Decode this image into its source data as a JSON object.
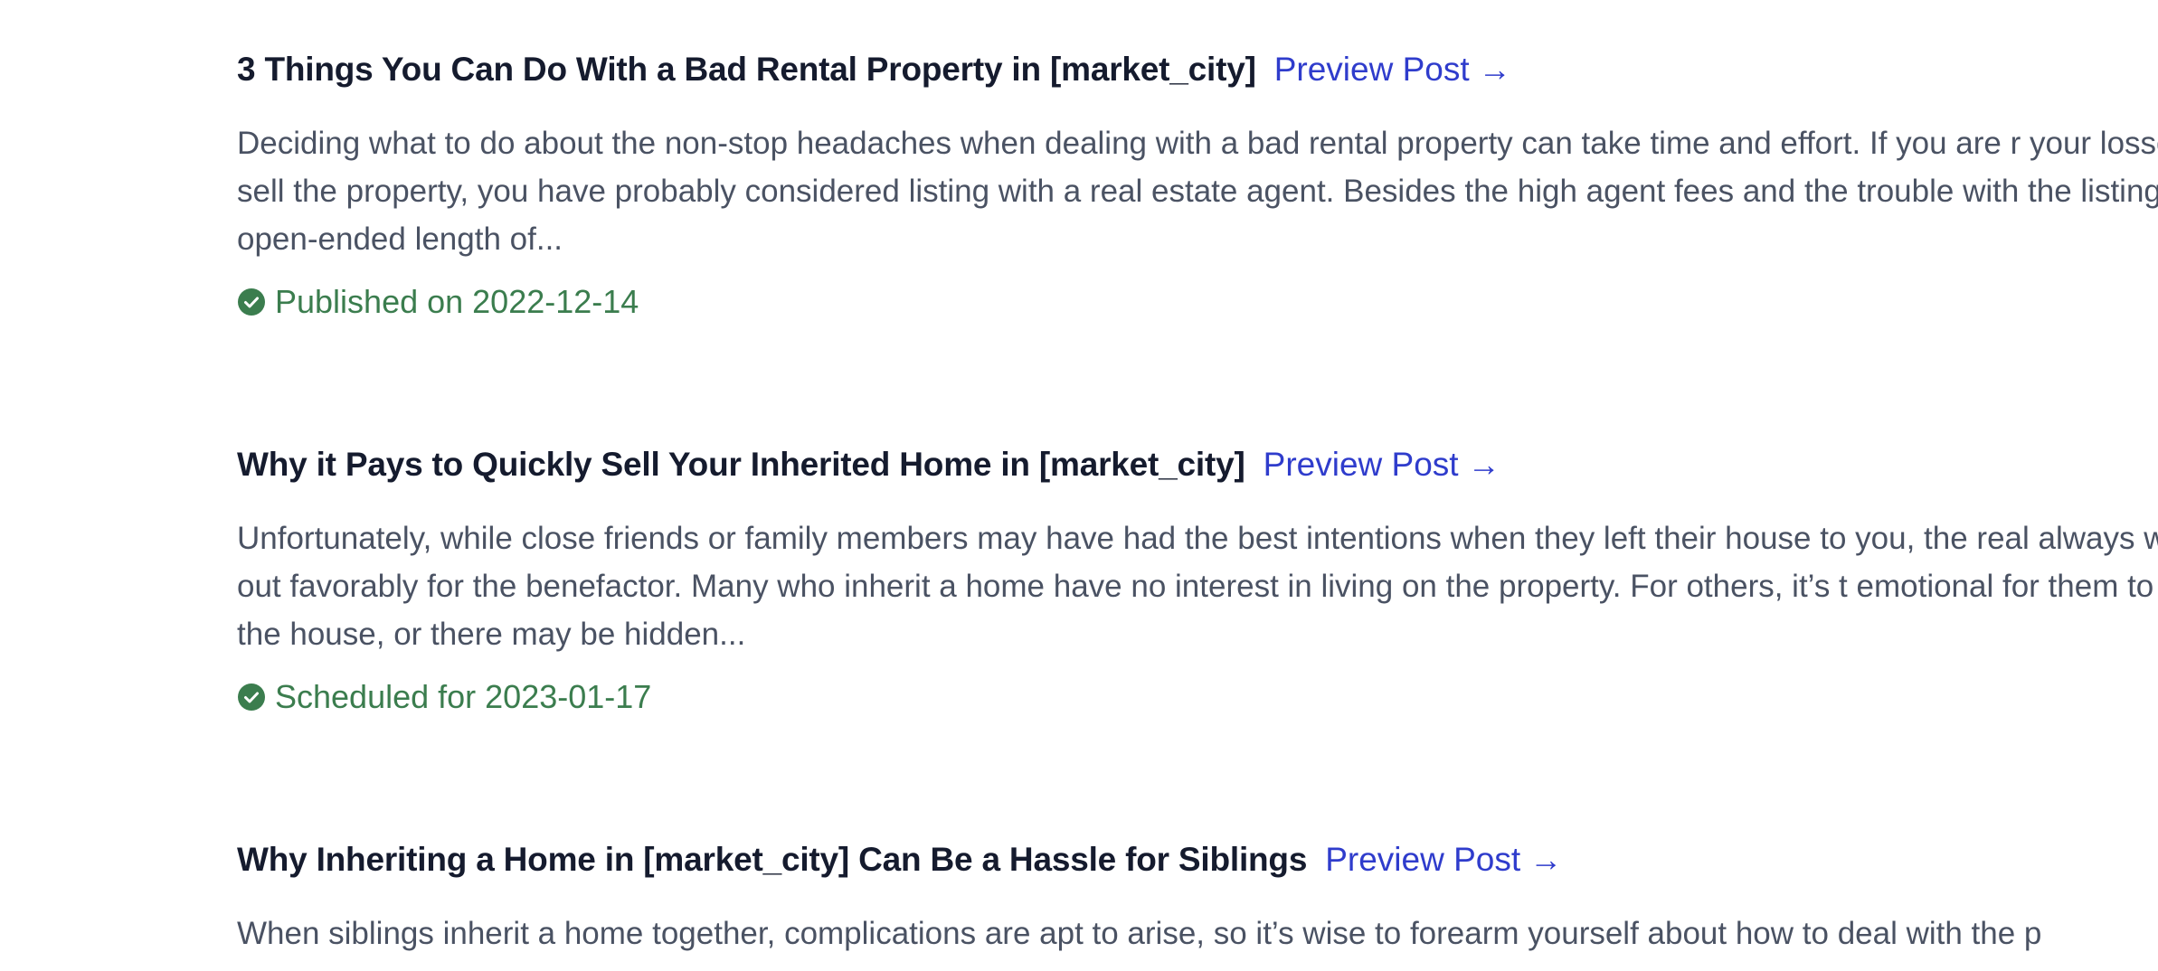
{
  "posts": [
    {
      "title": "3 Things You Can Do With a Bad Rental Property in [market_city]",
      "preview_label": "Preview Post",
      "arrow": "→",
      "excerpt": "Deciding what to do about the non-stop headaches when dealing with a bad rental property can take time and effort. If you are r your losses and sell the property, you have probably considered listing with a real estate agent. Besides the high agent fees and the trouble with the listing is the open-ended length of...",
      "status_icon": "check-circle-icon",
      "status_text": "Published on 2022-12-14"
    },
    {
      "title": "Why it Pays to Quickly Sell Your Inherited Home in [market_city]",
      "preview_label": "Preview Post",
      "arrow": "→",
      "excerpt": "Unfortunately, while close friends or family members may have had the best intentions when they left their house to you, the real always work out favorably for the benefactor. Many who inherit a home have no interest in living on the property. For others, it’s t emotional for them to be in the house, or there may be hidden...",
      "status_icon": "check-circle-icon",
      "status_text": "Scheduled for 2023-01-17"
    },
    {
      "title": "Why Inheriting a Home in [market_city] Can Be a Hassle for Siblings",
      "preview_label": "Preview Post",
      "arrow": "→",
      "excerpt": "When siblings inherit a home together, complications are apt to arise, so it’s wise to forearm yourself about how to deal with the p"
    }
  ],
  "colors": {
    "title": "#151b2e",
    "link": "#2f3ccc",
    "excerpt": "#4a5263",
    "status_green": "#3b7d4e"
  }
}
